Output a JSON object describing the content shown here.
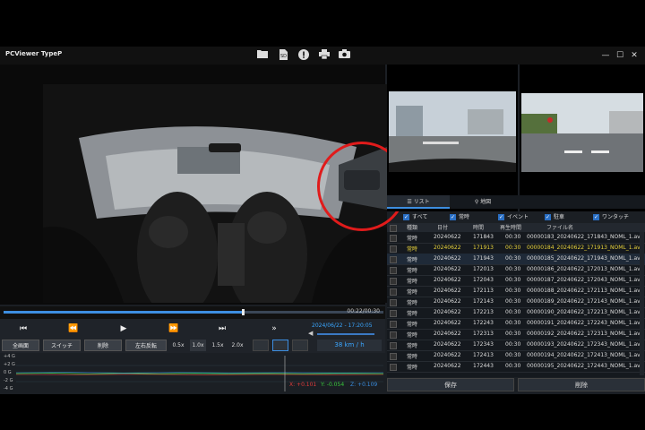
{
  "app": {
    "title": "PCViewer TypeP"
  },
  "toolbar": {
    "icons": [
      "folder-icon",
      "sd-card-icon",
      "alert-icon",
      "print-icon",
      "camera-icon"
    ],
    "sd_label": "SD"
  },
  "window": {
    "minimize": "—",
    "maximize": "☐",
    "close": "✕"
  },
  "playback": {
    "time": "00:22/00:30",
    "progress": 0.63,
    "datetime": "2024/06/22 - 17:20:05",
    "speed_readout": "38 km / h"
  },
  "controls": {
    "prev": "⏮",
    "rewind": "⏪",
    "play": "▶",
    "forward": "⏩",
    "next": "⏭",
    "skip": "»"
  },
  "buttons": {
    "fullscreen": "全画面",
    "switch": "スイッチ",
    "delete": "削除",
    "mirror": "左右反転",
    "speeds": [
      "0.5x",
      "1.0x",
      "1.5x",
      "2.0x"
    ]
  },
  "gsensor": {
    "labels": [
      "+4 G",
      "+2 G",
      "0 G",
      "-2 G",
      "-4 G"
    ],
    "x": "X: +0.101",
    "y": "Y: -0.054",
    "z": "Z: +0.109",
    "colors": {
      "x": "#e23b3b",
      "y": "#39c83c",
      "z": "#3a8ee0"
    }
  },
  "tabs": {
    "list": "リスト",
    "map": "地図"
  },
  "filters": [
    "すべて",
    "常時",
    "イベント",
    "駐車",
    "ワンタッチ"
  ],
  "table": {
    "headers": [
      "種類",
      "日付",
      "時間",
      "再生時間",
      "ファイル名"
    ],
    "rows": [
      [
        "常時",
        "20240622",
        "171843",
        "00:30",
        "00000183_20240622_171843_NOML_1.avi"
      ],
      [
        "常時",
        "20240622",
        "171913",
        "00:30",
        "00000184_20240622_171913_NOML_1.avi"
      ],
      [
        "常時",
        "20240622",
        "171943",
        "00:30",
        "00000185_20240622_171943_NOML_1.avi"
      ],
      [
        "常時",
        "20240622",
        "172013",
        "00:30",
        "00000186_20240622_172013_NOML_1.avi"
      ],
      [
        "常時",
        "20240622",
        "172043",
        "00:30",
        "00000187_20240622_172043_NOML_1.avi"
      ],
      [
        "常時",
        "20240622",
        "172113",
        "00:30",
        "00000188_20240622_172113_NOML_1.avi"
      ],
      [
        "常時",
        "20240622",
        "172143",
        "00:30",
        "00000189_20240622_172143_NOML_1.avi"
      ],
      [
        "常時",
        "20240622",
        "172213",
        "00:30",
        "00000190_20240622_172213_NOML_1.avi"
      ],
      [
        "常時",
        "20240622",
        "172243",
        "00:30",
        "00000191_20240622_172243_NOML_1.avi"
      ],
      [
        "常時",
        "20240622",
        "172313",
        "00:30",
        "00000192_20240622_172313_NOML_1.avi"
      ],
      [
        "常時",
        "20240622",
        "172343",
        "00:30",
        "00000193_20240622_172343_NOML_1.avi"
      ],
      [
        "常時",
        "20240622",
        "172413",
        "00:30",
        "00000194_20240622_172413_NOML_1.avi"
      ],
      [
        "常時",
        "20240622",
        "172443",
        "00:30",
        "00000195_20240622_172443_NOML_1.avi"
      ]
    ],
    "highlight_row": 1,
    "selected_row": 2
  },
  "footer": {
    "save": "保存",
    "delete": "削除"
  }
}
